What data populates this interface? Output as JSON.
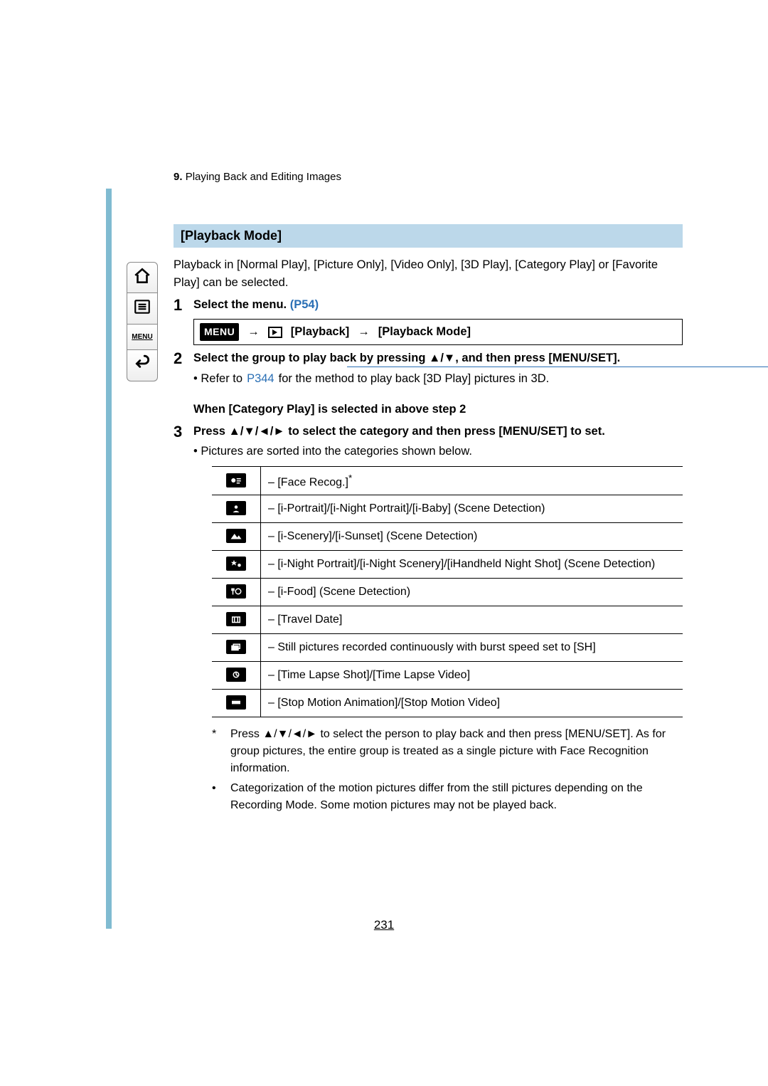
{
  "breadcrumb": {
    "number": "9.",
    "text": "Playing Back and Editing Images"
  },
  "section_title": "[Playback Mode]",
  "intro": "Playback in [Normal Play], [Picture Only], [Video Only], [3D Play], [Category Play] or [Favorite Play] can be selected.",
  "steps": {
    "s1": {
      "num": "1",
      "head_a": "Select the menu. ",
      "head_link": "(P54)",
      "menu_badge": "MENU",
      "arrow1": "→",
      "arrow2": "→",
      "path_a": "[Playback]",
      "path_b": "[Playback Mode]"
    },
    "s2": {
      "num": "2",
      "head": "Select the group to play back by pressing ▲/▼, and then press [MENU/SET].",
      "sub_prefix": "• Refer to ",
      "sub_link": "P344",
      "sub_suffix": " for the method to play back [3D Play] pictures in 3D."
    },
    "s3": {
      "num": "3",
      "pre_head": "When [Category Play] is selected in above step 2",
      "head": "Press ▲/▼/◄/► to select the category and then press [MENU/SET] to set.",
      "sub": "• Pictures are sorted into the categories shown below."
    }
  },
  "categories": [
    {
      "label": "– [Face Recog.]",
      "sup": "*"
    },
    {
      "label": "– [i-Portrait]/[i-Night Portrait]/[i-Baby] (Scene Detection)"
    },
    {
      "label": "– [i-Scenery]/[i-Sunset] (Scene Detection)"
    },
    {
      "label": "– [i-Night Portrait]/[i-Night Scenery]/[iHandheld Night Shot] (Scene Detection)"
    },
    {
      "label": "– [i-Food] (Scene Detection)"
    },
    {
      "label": "– [Travel Date]"
    },
    {
      "label": "– Still pictures recorded continuously with burst speed set to [SH]"
    },
    {
      "label": "– [Time Lapse Shot]/[Time Lapse Video]"
    },
    {
      "label": "– [Stop Motion Animation]/[Stop Motion Video]"
    }
  ],
  "footnotes": {
    "f1_mark": "*",
    "f1_text": "Press ▲/▼/◄/► to select the person to play back and then press [MENU/SET]. As for group pictures, the entire group is treated as a single picture with Face Recognition information.",
    "f2_mark": "•",
    "f2_text": "Categorization of the motion pictures differ from the still pictures depending on the Recording Mode. Some motion pictures may not be played back."
  },
  "page_number": "231",
  "sidebar": {
    "menu_label": "MENU"
  }
}
